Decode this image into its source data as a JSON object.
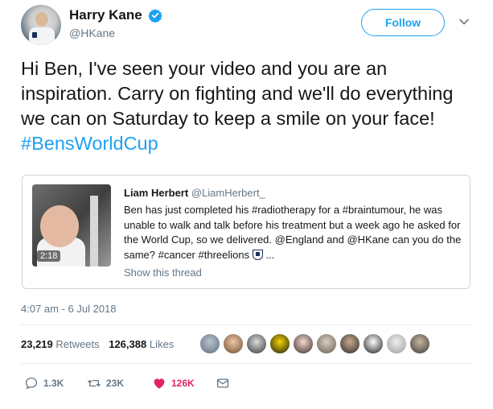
{
  "author": {
    "display_name": "Harry Kane",
    "handle": "@HKane",
    "verified": true
  },
  "follow_label": "Follow",
  "tweet": {
    "text": "Hi Ben, I've seen your video and you are an inspiration. Carry on fighting and we'll do everything we can on Saturday to keep a smile on your face! ",
    "hashtag": "#BensWorldCup"
  },
  "quoted_tweet": {
    "name": "Liam Herbert",
    "handle": "@LiamHerbert_",
    "text": "Ben has just completed his #radiotherapy for a #braintumour, he was unable to walk and talk before his treatment but a week ago he asked for the World Cup, so we delivered. @England and @HKane can you do the same? #cancer #threelions",
    "ellipsis": "...",
    "video_duration": "2:18",
    "show_thread": "Show this thread"
  },
  "timestamp": "4:07 am - 6 Jul 2018",
  "stats": {
    "retweets_count": "23,219",
    "retweets_label": "Retweets",
    "likes_count": "126,388",
    "likes_label": "Likes"
  },
  "actions": {
    "replies": "1.3K",
    "retweets": "23K",
    "likes": "126K"
  },
  "colors": {
    "accent": "#1da1f2",
    "like": "#e0245e",
    "secondary_text": "#657786"
  }
}
